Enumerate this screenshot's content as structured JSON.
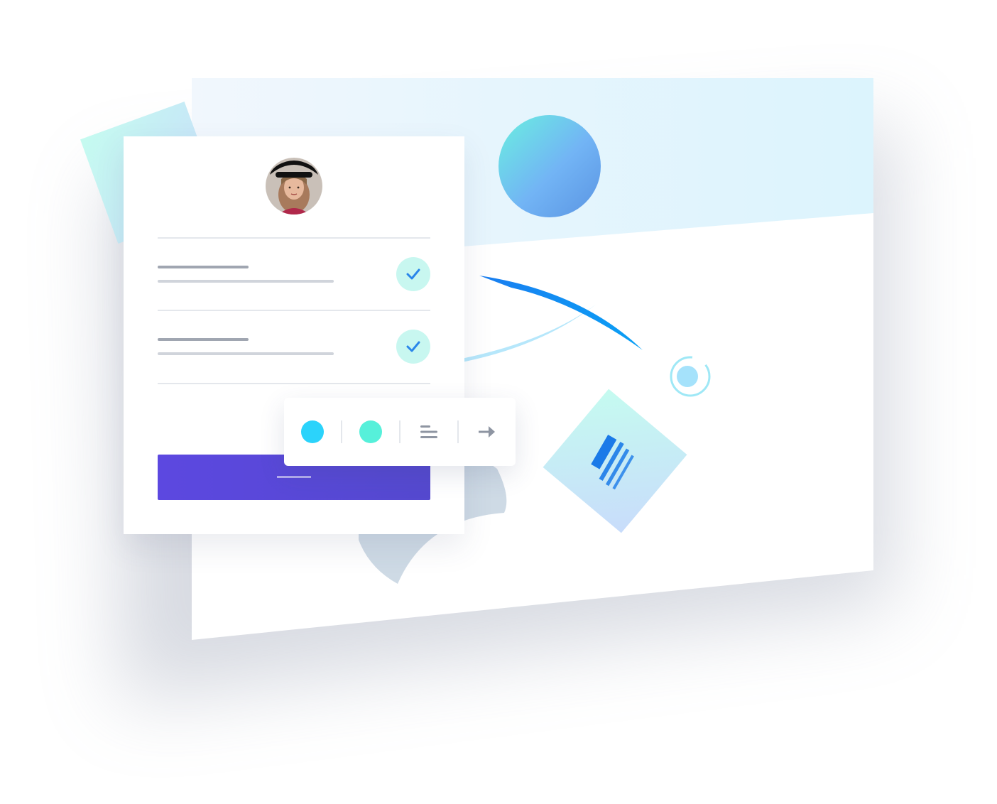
{
  "colors": {
    "primary_button": "#5b49dd",
    "check_bg": "#c8f7f0",
    "check_mark": "#2a86ea",
    "swatch_cyan": "#2bd3fb",
    "swatch_mint": "#56f0da",
    "line_dark": "#a0a6b1",
    "line_light": "#d0d4db",
    "accent_blue": "#0a7cf0"
  },
  "profile_card": {
    "avatar": "avatar-photo",
    "rows": [
      {
        "checked": true,
        "icon": "check-icon"
      },
      {
        "checked": true,
        "icon": "check-icon"
      }
    ],
    "submit_icon": "dash-icon"
  },
  "toolbar": {
    "items": [
      {
        "icon": "color-swatch-cyan",
        "color": "#2bd3fb"
      },
      {
        "icon": "color-swatch-mint",
        "color": "#56f0da"
      },
      {
        "icon": "align-left-icon"
      },
      {
        "icon": "arrow-right-icon"
      }
    ]
  },
  "decorations": {
    "tiles": [
      "grid-logo-icon",
      "stack-logo-icon"
    ],
    "circle": "gradient-circle",
    "target": "target-icon"
  }
}
